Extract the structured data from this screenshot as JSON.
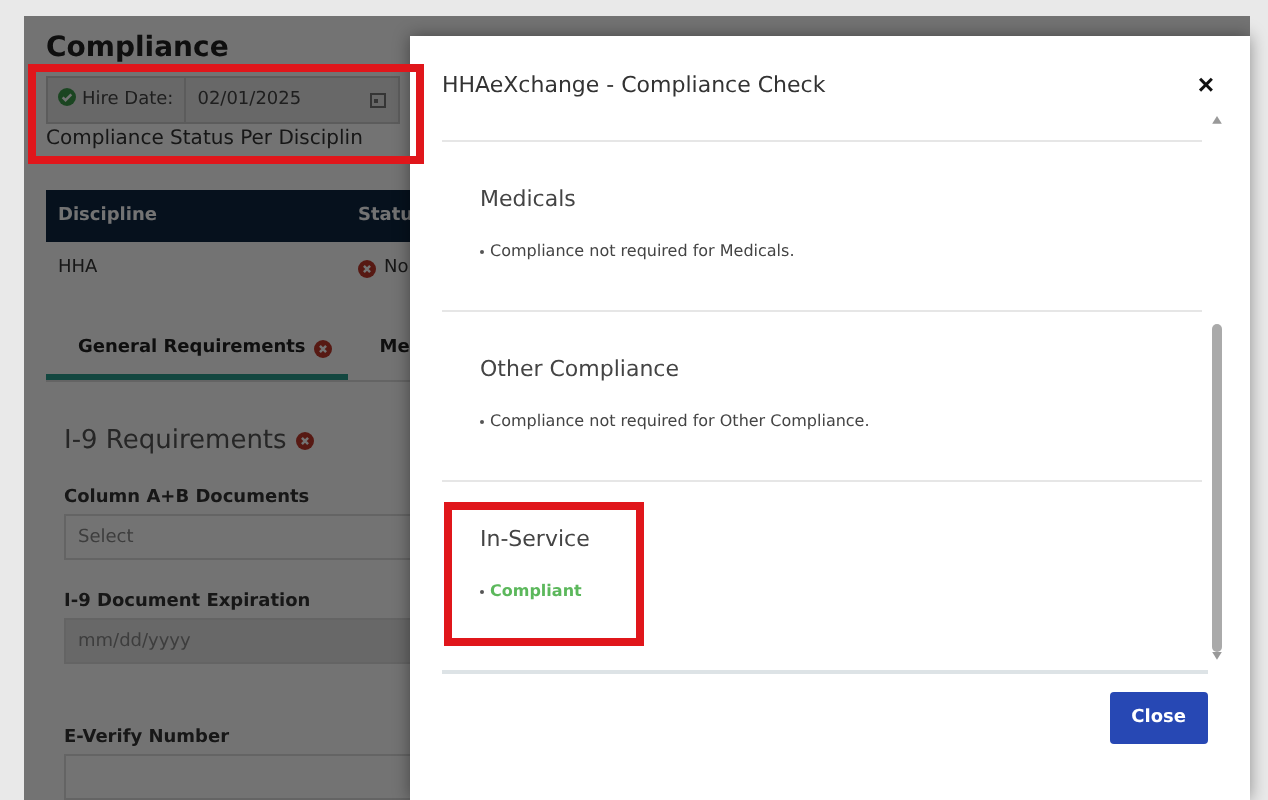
{
  "page": {
    "title": "Compliance",
    "hire_date": {
      "label": "Hire Date:",
      "value": "02/01/2025",
      "valid": true,
      "highlighted": true
    },
    "status_heading": "Compliance Status Per Disciplin",
    "table": {
      "columns": [
        "Discipline",
        "Statu"
      ],
      "rows": [
        {
          "discipline": "HHA",
          "status": "No",
          "compliant": false
        }
      ]
    },
    "tabs": [
      {
        "label": "General Requirements",
        "selected": true,
        "compliant": false
      },
      {
        "label": "Me",
        "selected": false
      }
    ],
    "section": {
      "title": "I-9 Requirements",
      "compliant": false
    },
    "fields": [
      {
        "label": "Column A+B Documents",
        "kind": "select",
        "placeholder": "Select"
      },
      {
        "label": "I-9 Document Expiration",
        "kind": "date",
        "placeholder": "mm/dd/yyyy"
      },
      {
        "label": "E-Verify Number",
        "kind": "text"
      }
    ]
  },
  "dialog": {
    "title": "HHAeXchange - Compliance Check",
    "close_symbol": "×",
    "sections": [
      {
        "title": "Medicals",
        "note": "Compliance not required for Medicals.",
        "compliant": false,
        "highlighted": false
      },
      {
        "title": "Other Compliance",
        "note": "Compliance not required for Other Compliance.",
        "compliant": false,
        "highlighted": false
      },
      {
        "title": "In-Service",
        "note": "Compliant",
        "compliant": true,
        "highlighted": true
      }
    ],
    "button": "Close"
  }
}
